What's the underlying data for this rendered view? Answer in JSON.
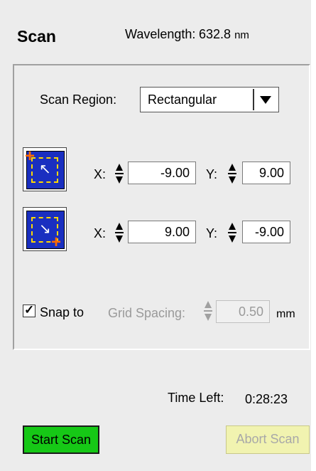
{
  "header": {
    "title": "Scan",
    "wavelength_label": "Wavelength:",
    "wavelength_value": "632.8",
    "wavelength_unit": "nm"
  },
  "scan_region": {
    "label": "Scan Region:",
    "selected": "Rectangular"
  },
  "corner1": {
    "x_label": "X:",
    "x_value": "-9.00",
    "y_label": "Y:",
    "y_value": "9.00"
  },
  "corner2": {
    "x_label": "X:",
    "x_value": "9.00",
    "y_label": "Y:",
    "y_value": "-9.00"
  },
  "snap": {
    "checked": true,
    "label": "Snap to",
    "grid_label": "Grid Spacing:",
    "grid_value": "0.50",
    "unit": "mm"
  },
  "time_left": {
    "label": "Time Left:",
    "value": "0:28:23"
  },
  "buttons": {
    "start": "Start Scan",
    "abort": "Abort Scan"
  },
  "colors": {
    "panel_bg": "#ececec",
    "start_green": "#16c816",
    "abort_yellow": "#f1f3b0",
    "corner_blue": "#1a2fc0"
  },
  "icons": [
    "top-left-corner-icon",
    "bottom-right-corner-icon",
    "dropdown-arrow-icon",
    "spin-arrows-icon",
    "check-icon"
  ]
}
